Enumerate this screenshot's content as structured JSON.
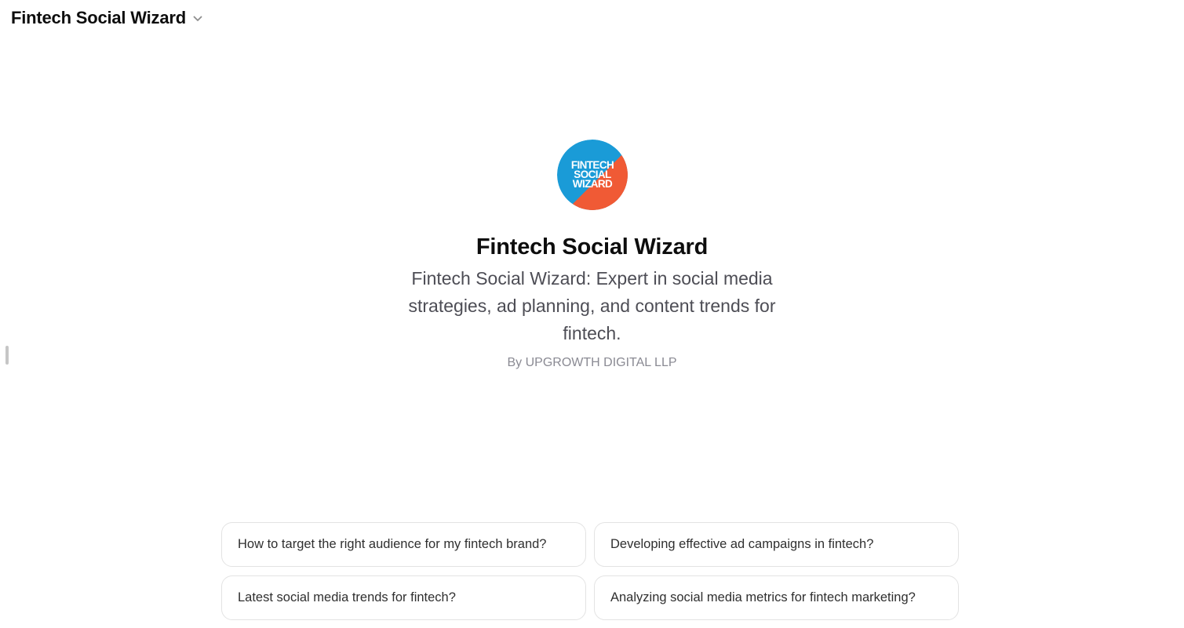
{
  "header": {
    "title": "Fintech Social Wizard",
    "dropdown_icon": "chevron-down-icon"
  },
  "gpt": {
    "logo_text": [
      "FINTECH",
      "SOCIAL",
      "WIZARD"
    ],
    "logo_colors": {
      "blue": "#1a9bd7",
      "orange": "#f05a35",
      "text": "#ffffff"
    },
    "name": "Fintech Social Wizard",
    "description": "Fintech Social Wizard: Expert in social media strategies, ad planning, and content trends for fintech.",
    "author": "By UPGROWTH DIGITAL LLP"
  },
  "suggestions": [
    {
      "label": "How to target the right audience for my fintech brand?"
    },
    {
      "label": "Developing effective ad campaigns in fintech?"
    },
    {
      "label": "Latest social media trends for fintech?"
    },
    {
      "label": "Analyzing social media metrics for fintech marketing?"
    }
  ]
}
